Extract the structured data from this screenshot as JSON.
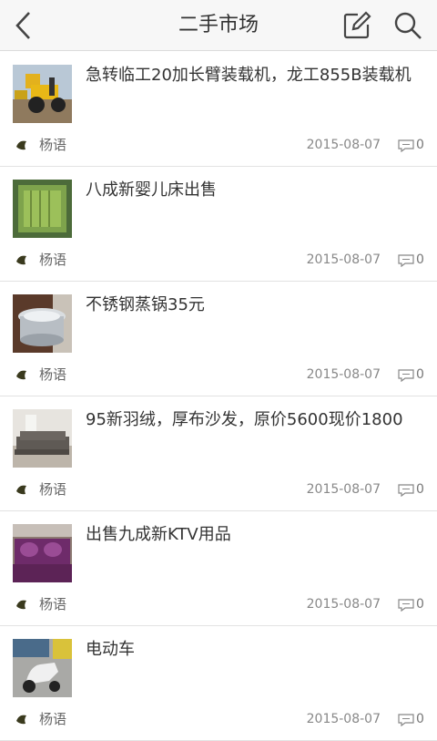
{
  "header": {
    "title": "二手市场",
    "back_icon": "chevron-left-icon",
    "edit_icon": "compose-icon",
    "search_icon": "search-icon"
  },
  "items": [
    {
      "title": "急转临工20加长臂装载机，龙工855B装载机",
      "author": "杨语",
      "date": "2015-08-07",
      "comments": "0",
      "thumb": "yellow-loader-photo"
    },
    {
      "title": "八成新婴儿床出售",
      "author": "杨语",
      "date": "2015-08-07",
      "comments": "0",
      "thumb": "green-crib-photo"
    },
    {
      "title": "不锈钢蒸锅35元",
      "author": "杨语",
      "date": "2015-08-07",
      "comments": "0",
      "thumb": "steamer-pot-photo"
    },
    {
      "title": "95新羽绒，厚布沙发，原价5600现价1800",
      "author": "杨语",
      "date": "2015-08-07",
      "comments": "0",
      "thumb": "sofa-photo"
    },
    {
      "title": "出售九成新KTV用品",
      "author": "杨语",
      "date": "2015-08-07",
      "comments": "0",
      "thumb": "purple-sofa-photo"
    },
    {
      "title": "电动车",
      "author": "杨语",
      "date": "2015-08-07",
      "comments": "0",
      "thumb": "scooter-photo"
    }
  ]
}
